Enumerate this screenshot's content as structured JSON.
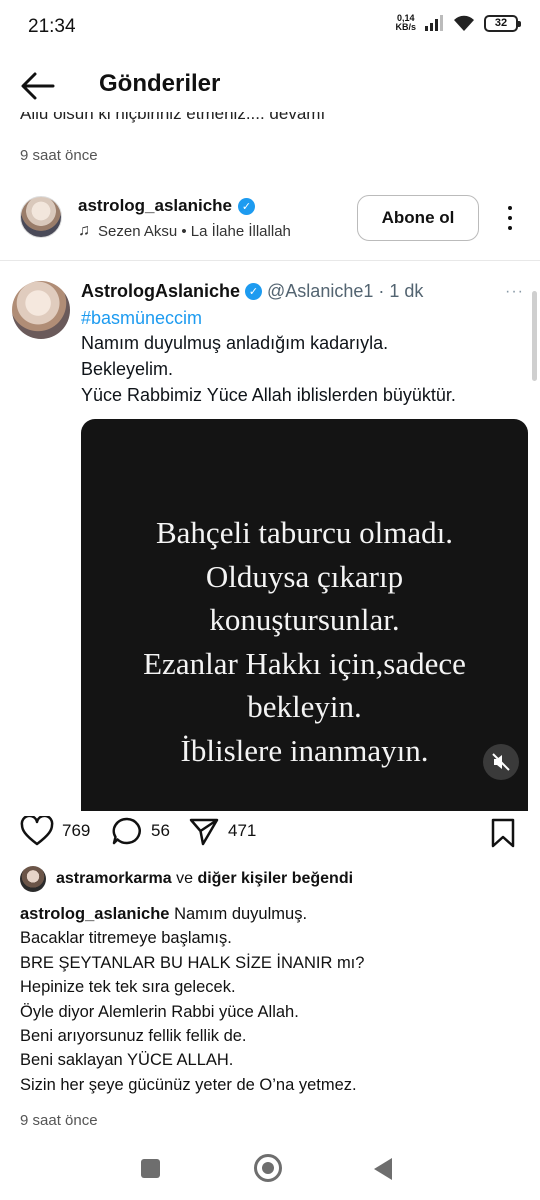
{
  "status_bar": {
    "time": "21:34",
    "net_speed_value": "0,14",
    "net_speed_unit": "KB/s",
    "battery": "32"
  },
  "header": {
    "title": "Gönderiler"
  },
  "previous_post": {
    "caption_partial": "Allu olsun ki hiçbiriniz etmeniz.... devamı",
    "time": "9 saat önce"
  },
  "post": {
    "username": "astrolog_aslaniche",
    "music": "Sezen Aksu • La İlahe İllallah",
    "follow_label": "Abone ol"
  },
  "tweet": {
    "display_name": "AstrologAslaniche",
    "handle": "@Aslaniche1",
    "separator": "·",
    "time": "1 dk",
    "more": "···",
    "hashtag": "#basmüneccim",
    "lines": [
      "Namım duyulmuş anladığım kadarıyla.",
      "Bekleyelim.",
      "Yüce Rabbimiz Yüce Allah iblislerden büyüktür."
    ],
    "image_lines": [
      "Bahçeli taburcu olmadı.",
      "Olduysa çıkarıp",
      "konuşturs­unlar.",
      "Ezanlar Hakkı için,sadece",
      "bekleyin.",
      "İblislere inanmayın."
    ]
  },
  "actions": {
    "likes": "769",
    "comments": "56",
    "shares": "471"
  },
  "liked_by": {
    "user": "astramorkarma",
    "connector": "ve",
    "others": "diğer kişiler beğendi"
  },
  "caption": {
    "username": "astrolog_aslaniche",
    "first_line": "Namım duyulmuş.",
    "lines": [
      "Bacaklar titremeye başlamış.",
      "BRE ŞEYTANLAR BU HALK SİZE İNANIR mı?",
      "Hepinize tek tek sıra gelecek.",
      "Öyle diyor Alemlerin Rabbi yüce Allah.",
      "Beni arıyorsunuz fellik fellik de.",
      "Beni saklayan YÜCE ALLAH.",
      "Sizin her şeye gücünüz yeter de O’na yetmez."
    ]
  },
  "post_time": "9 saat önce",
  "colors": {
    "verified": "#1d9bf0",
    "hashtag": "#1d9bf0",
    "image_bg": "#141414"
  },
  "icons": [
    "back-arrow-icon",
    "music-note-icon",
    "verified-icon",
    "more-vertical-icon",
    "heart-icon",
    "comment-icon",
    "send-icon",
    "bookmark-icon",
    "mute-icon"
  ]
}
